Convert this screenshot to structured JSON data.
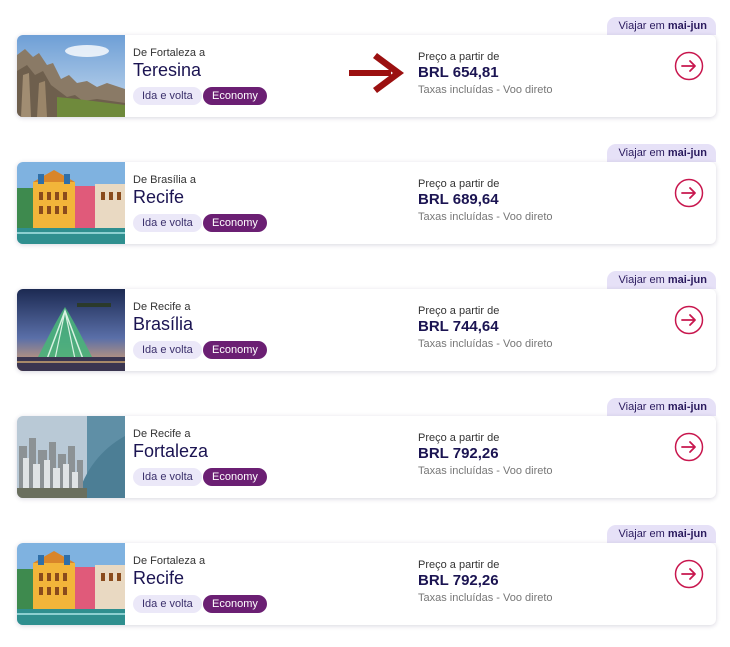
{
  "colors": {
    "title_text": "#1b1452",
    "class_badge": "#6b1f73",
    "trip_badge": "#ebe8f8",
    "travel_tag": "#e6e1f7",
    "go_button": "#c8174e",
    "annotation_arrow": "#9b1010"
  },
  "deals": [
    {
      "travel_prefix": "Viajar em",
      "travel_period": "mai-jun",
      "origin": "De Fortaleza a",
      "destination": "Teresina",
      "trip_type": "Ida e volta",
      "cabin_class": "Economy",
      "price_label": "Preço a partir de",
      "price": "BRL 654,81",
      "price_note": "Taxas incluídas - Voo direto",
      "image": "rock-formations-photo",
      "icon": "arrow-right-circle-icon"
    },
    {
      "travel_prefix": "Viajar em",
      "travel_period": "mai-jun",
      "origin": "De Brasília a",
      "destination": "Recife",
      "trip_type": "Ida e volta",
      "cabin_class": "Economy",
      "price_label": "Preço a partir de",
      "price": "BRL 689,64",
      "price_note": "Taxas incluídas - Voo direto",
      "image": "colorful-buildings-photo",
      "icon": "arrow-right-circle-icon"
    },
    {
      "travel_prefix": "Viajar em",
      "travel_period": "mai-jun",
      "origin": "De Recife a",
      "destination": "Brasília",
      "trip_type": "Ida e volta",
      "cabin_class": "Economy",
      "price_label": "Preço a partir de",
      "price": "BRL 744,64",
      "price_note": "Taxas incluídas - Voo direto",
      "image": "cathedral-photo",
      "icon": "arrow-right-circle-icon"
    },
    {
      "travel_prefix": "Viajar em",
      "travel_period": "mai-jun",
      "origin": "De Recife a",
      "destination": "Fortaleza",
      "trip_type": "Ida e volta",
      "cabin_class": "Economy",
      "price_label": "Preço a partir de",
      "price": "BRL 792,26",
      "price_note": "Taxas incluídas - Voo direto",
      "image": "city-skyline-photo",
      "icon": "arrow-right-circle-icon"
    },
    {
      "travel_prefix": "Viajar em",
      "travel_period": "mai-jun",
      "origin": "De Fortaleza a",
      "destination": "Recife",
      "trip_type": "Ida e volta",
      "cabin_class": "Economy",
      "price_label": "Preço a partir de",
      "price": "BRL 792,26",
      "price_note": "Taxas incluídas - Voo direto",
      "image": "colorful-buildings-photo",
      "icon": "arrow-right-circle-icon"
    }
  ],
  "annotation": {
    "icon": "red-arrow-right-icon"
  }
}
